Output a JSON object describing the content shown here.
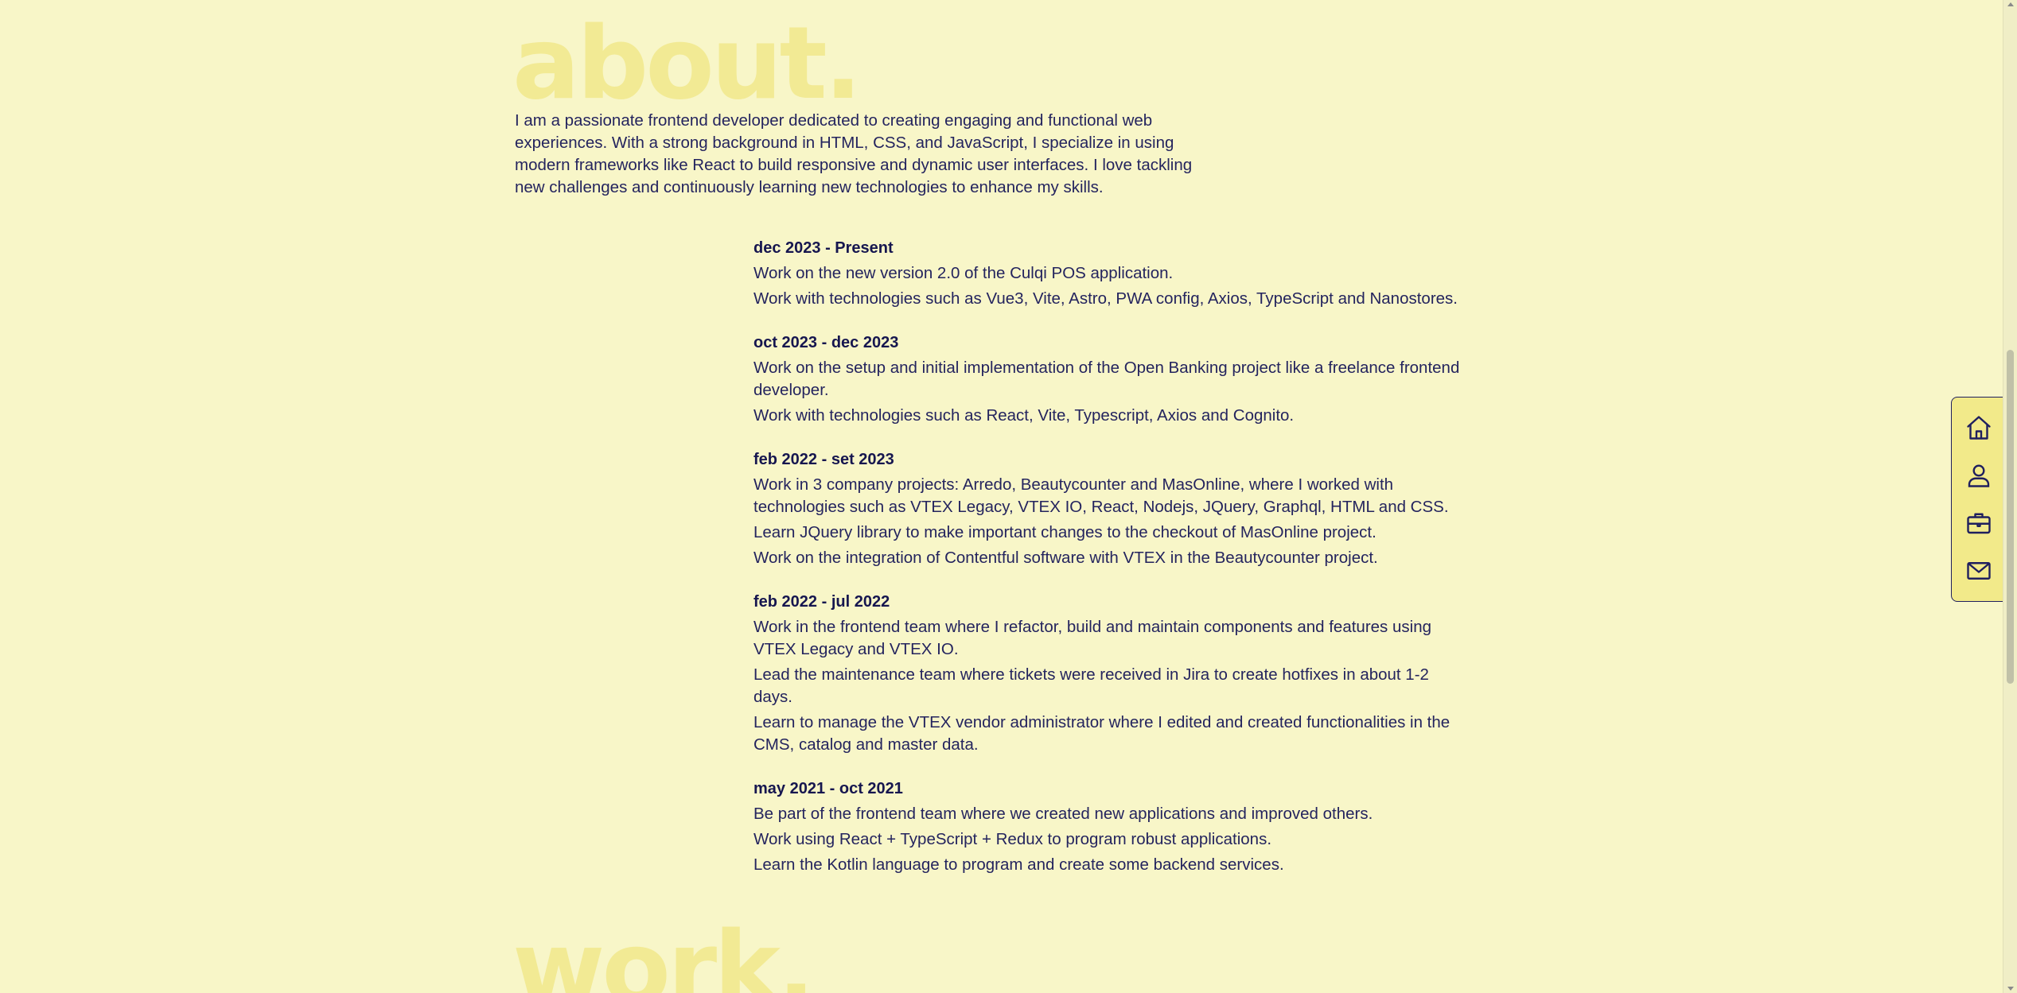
{
  "about": {
    "title": "about.",
    "description": "I am a passionate frontend developer dedicated to creating engaging and functional web experiences. With a strong background in HTML, CSS, and JavaScript, I specialize in using modern frameworks like React to build responsive and dynamic user interfaces. I love tackling new challenges and continuously learning new technologies to enhance my skills."
  },
  "experience": [
    {
      "date": "dec 2023 - Present",
      "items": [
        "Work on the new version 2.0 of the Culqi POS application.",
        "Work with technologies such as Vue3, Vite, Astro, PWA config, Axios, TypeScript and Nanostores."
      ]
    },
    {
      "date": "oct 2023 - dec 2023",
      "items": [
        "Work on the setup and initial implementation of the Open Banking project like a freelance frontend developer.",
        "Work with technologies such as React, Vite, Typescript, Axios and Cognito."
      ]
    },
    {
      "date": "feb 2022 - set 2023",
      "items": [
        "Work in 3 company projects: Arredo, Beautycounter and MasOnline, where I worked with technologies such as VTEX Legacy, VTEX IO, React, Nodejs, JQuery, Graphql, HTML and CSS.",
        "Learn JQuery library to make important changes to the checkout of MasOnline project.",
        "Work on the integration of Contentful software with VTEX in the Beautycounter project."
      ]
    },
    {
      "date": "feb 2022 - jul 2022",
      "items": [
        "Work in the frontend team where I refactor, build and maintain components and features using VTEX Legacy and VTEX IO.",
        "Lead the maintenance team where tickets were received in Jira to create hotfixes in about 1-2 days.",
        "Learn to manage the VTEX vendor administrator where I edited and created functionalities in the CMS, catalog and master data."
      ]
    },
    {
      "date": "may 2021 - oct 2021",
      "items": [
        "Be part of the frontend team where we created new applications and improved others.",
        "Work using React + TypeScript + Redux to program robust applications.",
        "Learn the Kotlin language to program and create some backend services."
      ]
    }
  ],
  "work": {
    "title": "work."
  },
  "nav": {
    "items": [
      {
        "icon": "home-icon"
      },
      {
        "icon": "user-icon"
      },
      {
        "icon": "briefcase-icon"
      },
      {
        "icon": "mail-icon"
      }
    ]
  },
  "colors": {
    "background": "#f8f6c8",
    "heading_faded": "#f2ea94",
    "text": "#1f1f5e",
    "dock": "#f2ea8a"
  }
}
